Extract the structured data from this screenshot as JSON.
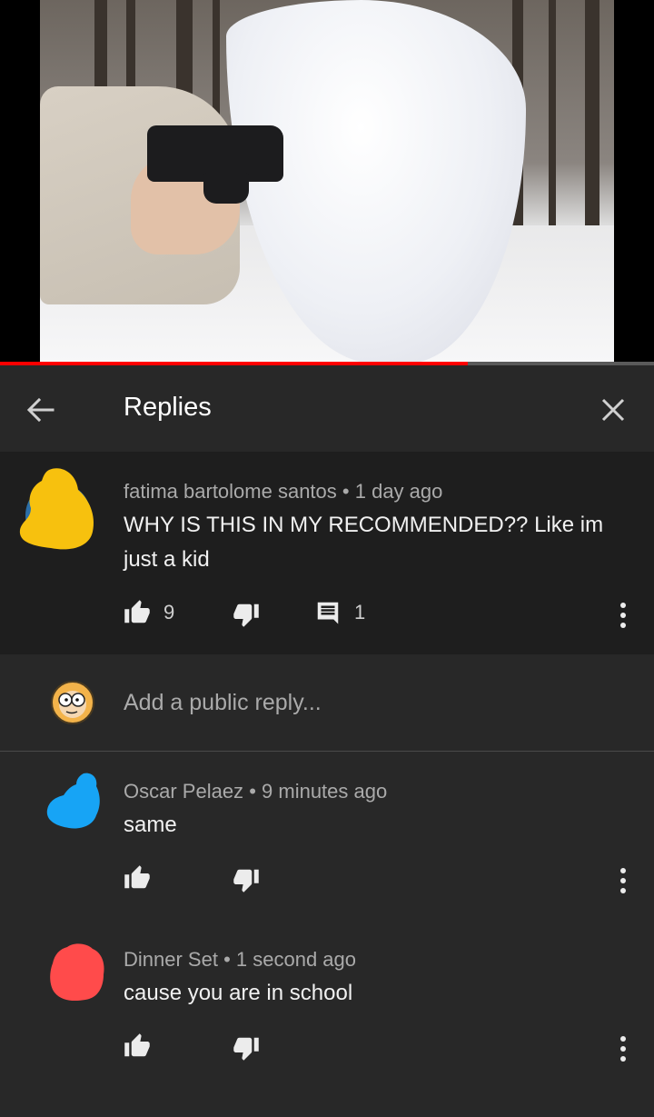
{
  "video": {
    "progress_fraction": 0.715
  },
  "header": {
    "title": "Replies"
  },
  "top_comment": {
    "author": "fatima bartolome santos",
    "time": "1 day ago",
    "text": "WHY IS THIS IN MY RECOMMENDED?? Like im just a kid",
    "likes": "9",
    "replies_count": "1",
    "avatar_color": "#f7c10e"
  },
  "add_reply": {
    "placeholder": "Add a public reply..."
  },
  "replies": [
    {
      "author": "Oscar Pelaez",
      "time": "9 minutes ago",
      "text": "same",
      "avatar_color": "#17a4f5"
    },
    {
      "author": "Dinner Set",
      "time": "1 second ago",
      "text": "cause you are in school",
      "avatar_color": "#ff4b4b"
    }
  ],
  "separator": "•",
  "icons": {
    "back": "arrow-left-icon",
    "close": "close-icon",
    "like": "thumbs-up-icon",
    "dislike": "thumbs-down-icon",
    "reply": "comment-icon",
    "more": "more-vert-icon"
  }
}
